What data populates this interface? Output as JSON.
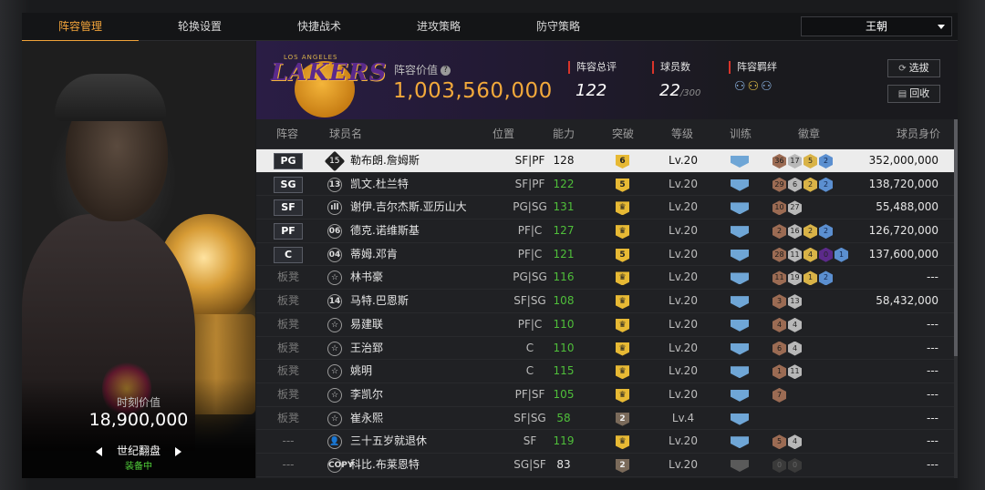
{
  "nav": {
    "tabs": [
      {
        "label": "阵容管理",
        "active": true
      },
      {
        "label": "轮换设置",
        "active": false
      },
      {
        "label": "快捷战术",
        "active": false
      },
      {
        "label": "进攻策略",
        "active": false
      },
      {
        "label": "防守策略",
        "active": false
      }
    ],
    "team_select": "王朝"
  },
  "player_card": {
    "value_label": "时刻价值",
    "value": "18,900,000",
    "name": "世纪翻盘",
    "status": "装备中"
  },
  "header": {
    "logo_small_text": "LOS ANGELES",
    "logo_text": "LAKERS",
    "lineup_value_label": "阵容价值",
    "lineup_value": "1,003,560,000",
    "rating_label": "阵容总评",
    "rating": "122",
    "players_label": "球员数",
    "players_count": "22",
    "players_max": "/300",
    "bond_label": "阵容羁绊",
    "buttons": {
      "pick": "选拔",
      "recycle": "回收"
    }
  },
  "table": {
    "headers": {
      "lineup": "阵容",
      "name": "球员名",
      "position": "位置",
      "ability": "能力",
      "breakthrough": "突破",
      "level": "等级",
      "training": "训练",
      "badges": "徽章",
      "value": "球员身价"
    },
    "rows": [
      {
        "slot": "PG",
        "starter": true,
        "num": "15",
        "name": "勒布朗.詹姆斯",
        "pos": "SF|PF",
        "ability": "128",
        "break": "6",
        "level": "Lv.20",
        "badges": [
          {
            "v": "36",
            "c": "brown"
          },
          {
            "v": "17",
            "c": "silver"
          },
          {
            "v": "5",
            "c": "gold"
          },
          {
            "v": "2",
            "c": "blue"
          }
        ],
        "price": "352,000,000",
        "selected": true
      },
      {
        "slot": "SG",
        "starter": true,
        "num": "13",
        "name": "凯文.杜兰特",
        "pos": "SF|PF",
        "ability": "122",
        "break": "5",
        "level": "Lv.20",
        "badges": [
          {
            "v": "29",
            "c": "brown"
          },
          {
            "v": "6",
            "c": "silver"
          },
          {
            "v": "2",
            "c": "gold"
          },
          {
            "v": "2",
            "c": "blue"
          }
        ],
        "price": "138,720,000"
      },
      {
        "slot": "SF",
        "starter": true,
        "num": "ıll",
        "name": "谢伊.吉尔杰斯.亚历山大",
        "pos": "PG|SG",
        "ability": "131",
        "break": "♛",
        "level": "Lv.20",
        "badges": [
          {
            "v": "10",
            "c": "brown"
          },
          {
            "v": "27",
            "c": "silver"
          }
        ],
        "price": "55,488,000"
      },
      {
        "slot": "PF",
        "starter": true,
        "num": "06",
        "name": "德克.诺维斯基",
        "pos": "PF|C",
        "ability": "127",
        "break": "♛",
        "level": "Lv.20",
        "badges": [
          {
            "v": "2",
            "c": "brown"
          },
          {
            "v": "16",
            "c": "silver"
          },
          {
            "v": "2",
            "c": "gold"
          },
          {
            "v": "2",
            "c": "blue"
          }
        ],
        "price": "126,720,000"
      },
      {
        "slot": "C",
        "starter": true,
        "num": "04",
        "name": "蒂姆.邓肯",
        "pos": "PF|C",
        "ability": "121",
        "break": "5",
        "level": "Lv.20",
        "badges": [
          {
            "v": "28",
            "c": "brown"
          },
          {
            "v": "11",
            "c": "silver"
          },
          {
            "v": "4",
            "c": "gold"
          },
          {
            "v": "0",
            "c": "purple"
          },
          {
            "v": "1",
            "c": "blue"
          }
        ],
        "price": "137,600,000"
      },
      {
        "slot": "板凳",
        "starter": false,
        "num": "☆",
        "name": "林书豪",
        "pos": "PG|SG",
        "ability": "116",
        "break": "♛",
        "level": "Lv.20",
        "badges": [
          {
            "v": "11",
            "c": "brown"
          },
          {
            "v": "19",
            "c": "silver"
          },
          {
            "v": "1",
            "c": "gold"
          },
          {
            "v": "2",
            "c": "blue"
          }
        ],
        "price": "---"
      },
      {
        "slot": "板凳",
        "starter": false,
        "num": "14",
        "name": "马特.巴恩斯",
        "pos": "SF|SG",
        "ability": "108",
        "break": "♛",
        "level": "Lv.20",
        "badges": [
          {
            "v": "3",
            "c": "brown"
          },
          {
            "v": "13",
            "c": "silver"
          }
        ],
        "price": "58,432,000"
      },
      {
        "slot": "板凳",
        "starter": false,
        "num": "☆",
        "name": "易建联",
        "pos": "PF|C",
        "ability": "110",
        "break": "♛",
        "level": "Lv.20",
        "badges": [
          {
            "v": "4",
            "c": "brown"
          },
          {
            "v": "4",
            "c": "silver"
          }
        ],
        "price": "---"
      },
      {
        "slot": "板凳",
        "starter": false,
        "num": "☆",
        "name": "王治郅",
        "pos": "C",
        "ability": "110",
        "break": "♛",
        "level": "Lv.20",
        "badges": [
          {
            "v": "6",
            "c": "brown"
          },
          {
            "v": "4",
            "c": "silver"
          }
        ],
        "price": "---"
      },
      {
        "slot": "板凳",
        "starter": false,
        "num": "☆",
        "name": "姚明",
        "pos": "C",
        "ability": "115",
        "break": "♛",
        "level": "Lv.20",
        "badges": [
          {
            "v": "1",
            "c": "brown"
          },
          {
            "v": "11",
            "c": "silver"
          }
        ],
        "price": "---"
      },
      {
        "slot": "板凳",
        "starter": false,
        "num": "☆",
        "name": "李凯尔",
        "pos": "PF|SF",
        "ability": "105",
        "break": "♛",
        "level": "Lv.20",
        "badges": [
          {
            "v": "7",
            "c": "brown"
          }
        ],
        "price": "---"
      },
      {
        "slot": "板凳",
        "starter": false,
        "num": "☆",
        "name": "崔永熙",
        "pos": "SF|SG",
        "ability": "58",
        "break": "2",
        "level": "Lv.4",
        "badges": [],
        "price": "---"
      },
      {
        "slot": "---",
        "starter": false,
        "num": "👤",
        "name": "三十五岁就退休",
        "pos": "SF",
        "ability": "119",
        "break": "♛",
        "level": "Lv.20",
        "badges": [
          {
            "v": "5",
            "c": "brown"
          },
          {
            "v": "4",
            "c": "silver"
          }
        ],
        "price": "---"
      },
      {
        "slot": "---",
        "starter": false,
        "num": "COPY",
        "name": "科比.布莱恩特",
        "pos": "SG|SF",
        "ability": "83",
        "break": "2",
        "level": "Lv.20",
        "badges": [
          {
            "v": "0",
            "c": "dim"
          },
          {
            "v": "0",
            "c": "dim"
          }
        ],
        "price": "---"
      }
    ]
  }
}
